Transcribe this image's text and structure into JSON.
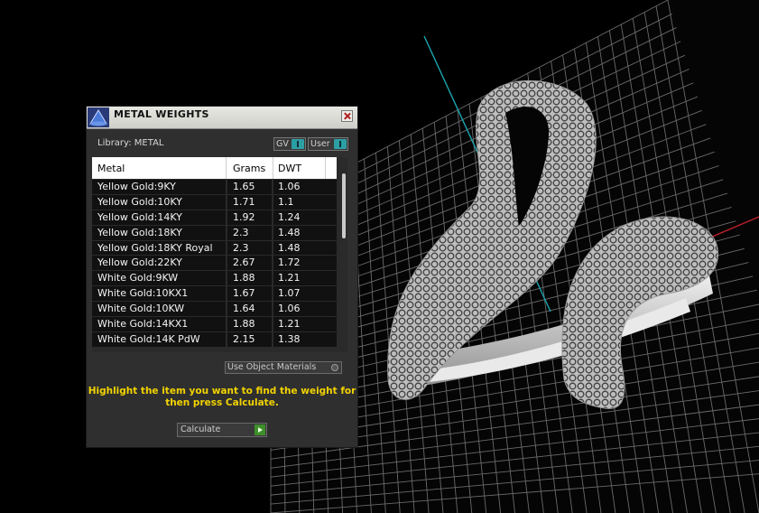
{
  "panel": {
    "title": "METAL WEIGHTS",
    "library_label": "Library: METAL",
    "toggles": {
      "gv": "GV",
      "user": "User"
    },
    "table": {
      "headers": [
        "Metal",
        "Grams",
        "DWT"
      ],
      "rows": [
        [
          "Yellow Gold:9KY",
          "1.65",
          "1.06"
        ],
        [
          "Yellow Gold:10KY",
          "1.71",
          "1.1"
        ],
        [
          "Yellow Gold:14KY",
          "1.92",
          "1.24"
        ],
        [
          "Yellow Gold:18KY",
          "2.3",
          "1.48"
        ],
        [
          "Yellow Gold:18KY Royal",
          "2.3",
          "1.48"
        ],
        [
          "Yellow Gold:22KY",
          "2.67",
          "1.72"
        ],
        [
          "White Gold:9KW",
          "1.88",
          "1.21"
        ],
        [
          "White Gold:10KX1",
          "1.67",
          "1.07"
        ],
        [
          "White Gold:10KW",
          "1.64",
          "1.06"
        ],
        [
          "White Gold:14KX1",
          "1.88",
          "1.21"
        ],
        [
          "White Gold:14K PdW",
          "2.15",
          "1.38"
        ]
      ]
    },
    "use_object_materials": "Use Object Materials",
    "instructions": "Highlight the item you want to find the weight for then press Calculate.",
    "calculate_label": "Calculate"
  },
  "colors": {
    "instruction_text": "#f2d300",
    "toggle_accent": "#2c9fa5",
    "calculate_arrow": "#3e8e2a"
  },
  "icons": {
    "app": "metal-weights-cone-icon",
    "close": "close-icon",
    "calculate": "play-arrow-icon"
  }
}
